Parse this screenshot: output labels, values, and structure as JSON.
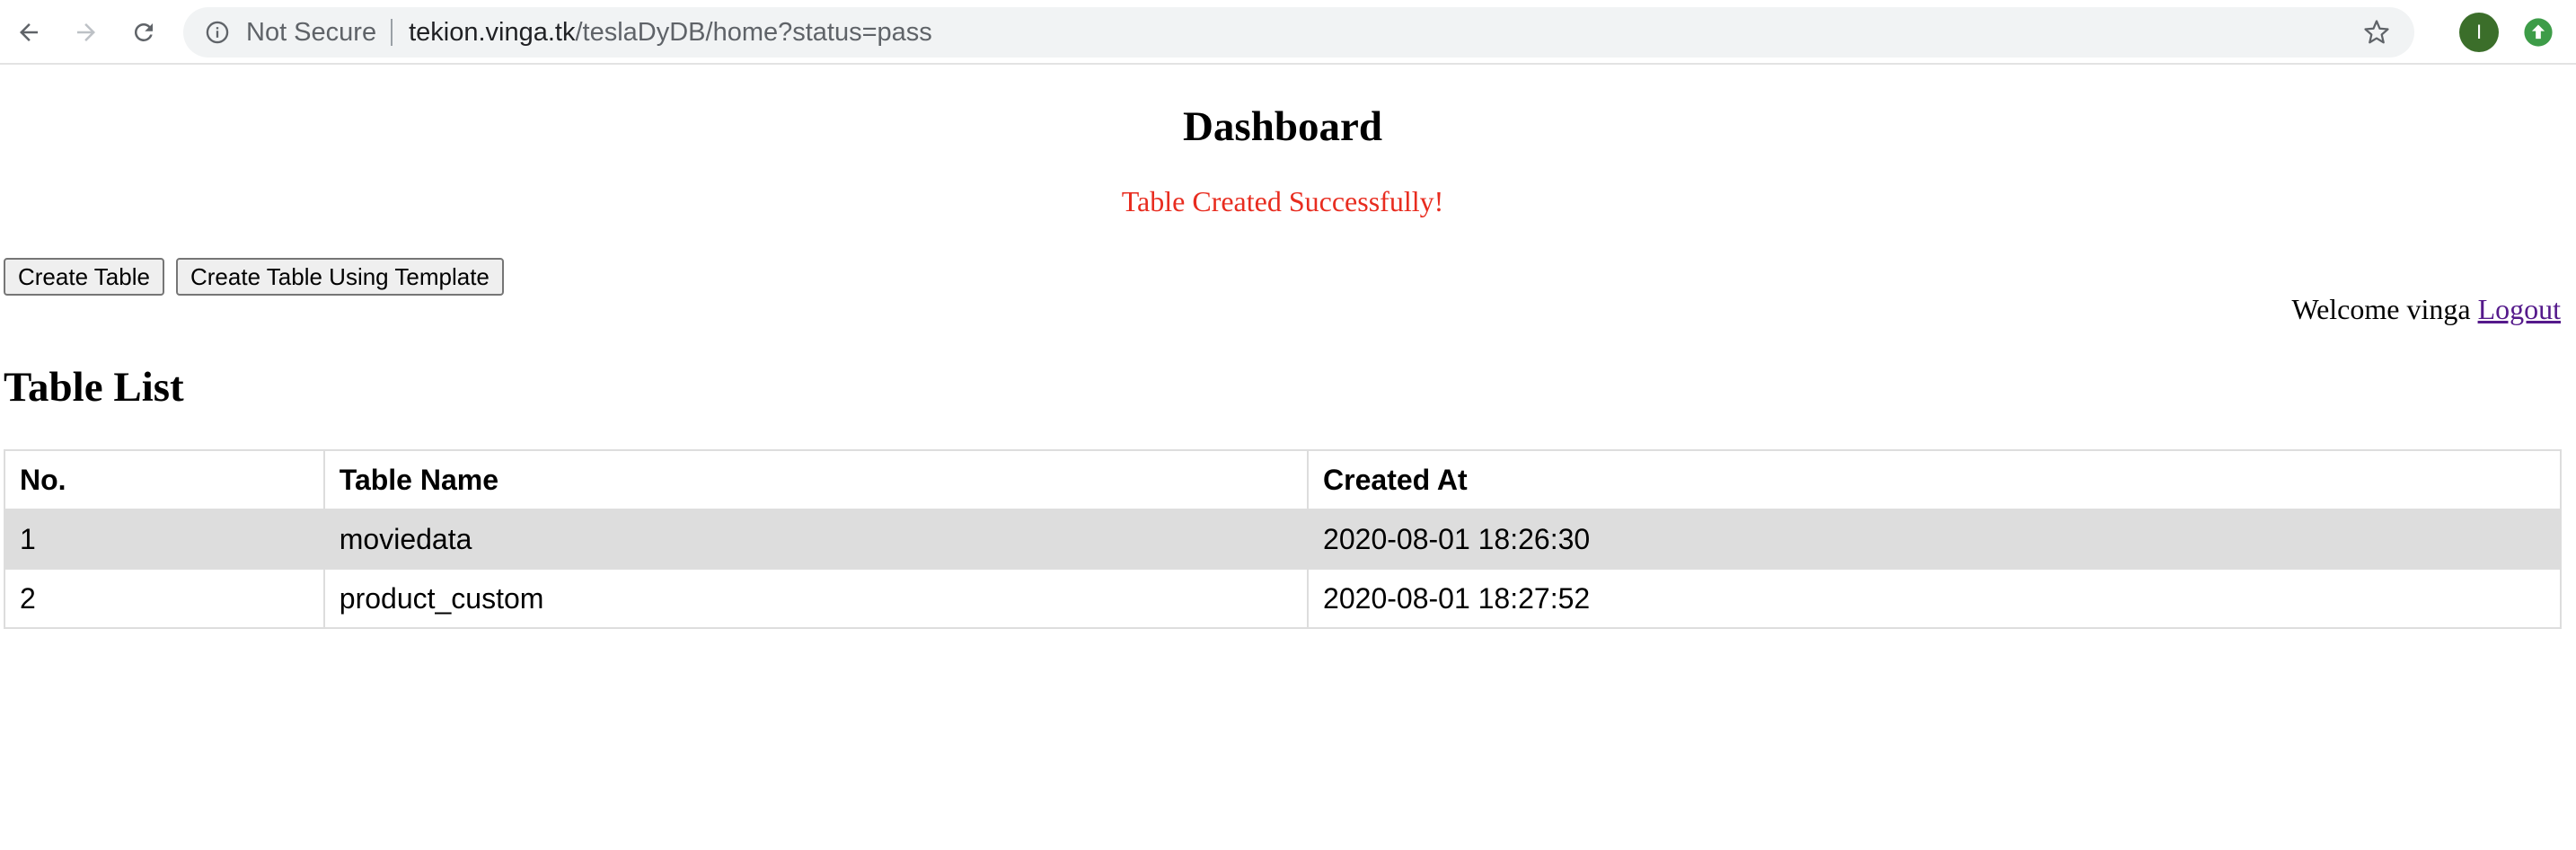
{
  "browser": {
    "not_secure_label": "Not Secure",
    "url_host": "tekion.vinga.tk",
    "url_path": "/teslaDyDB/home?status=pass",
    "avatar_letter": "I",
    "icons": [
      "back-icon",
      "forward-icon",
      "reload-icon",
      "info-icon",
      "star-icon",
      "extension-icon"
    ]
  },
  "page": {
    "title": "Dashboard",
    "status_message": "Table Created Successfully!",
    "status_color": "#e82c1f",
    "buttons": {
      "create_table": "Create Table",
      "create_table_template": "Create Table Using Template"
    },
    "welcome_text": "Welcome vinga",
    "logout_label": "Logout",
    "section_title": "Table List"
  },
  "table": {
    "headers": [
      "No.",
      "Table Name",
      "Created At"
    ],
    "rows": [
      {
        "no": "1",
        "name": "moviedata",
        "created": "2020-08-01 18:26:30"
      },
      {
        "no": "2",
        "name": "product_custom",
        "created": "2020-08-01 18:27:52"
      }
    ]
  }
}
